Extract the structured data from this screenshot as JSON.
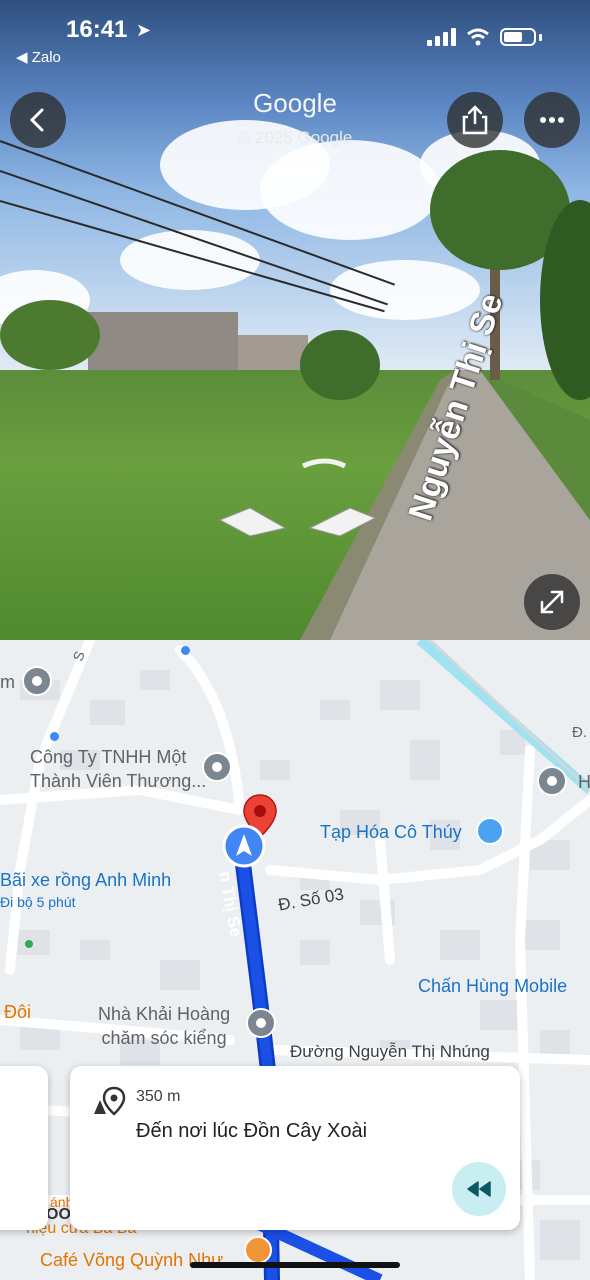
{
  "status_bar": {
    "time": "16:41",
    "back_app": "◀ Zalo"
  },
  "street_view": {
    "title": "Google",
    "copyright": "© 2025 Google",
    "street_name": "Nguyễn Thị Se",
    "icons": {
      "back": "chevron-left-icon",
      "share": "share-icon",
      "more": "more-icon",
      "expand": "expand-icon"
    }
  },
  "map": {
    "labels": {
      "company": [
        "Công Ty TNHH Một",
        "Thành Viên Thương..."
      ],
      "grocery": "Tạp Hóa Cô Thúy",
      "parking": "Bãi xe rồng Anh Minh",
      "parking_sub": "Đi bộ 5 phút",
      "street_03": "Đ. Số 03",
      "route_street": "n Thị Se",
      "mobile": "Chấn Hùng Mobile",
      "doi": "Đôi",
      "garden": [
        "Nhà Khải Hoàng",
        "chăm sóc kiểng"
      ],
      "nhung": "Đường Nguyễn Thị Nhúng",
      "cafe": "Café Võng Quỳnh Như",
      "partial_top": "S",
      "partial_m": "m",
      "partial_h": "H",
      "partial_d": "Đ.",
      "partial_hieu": "hiệu cửa Ba Ba",
      "partial_oo": "OO",
      "partial_anh": "ánh"
    },
    "colors": {
      "route": "#1a50e6",
      "marker": "#ea4335",
      "nav_dot": "#4285f4"
    }
  },
  "navigation_card": {
    "distance": "350 m",
    "instruction": "Đến nơi lúc Đồn Cây Xoài",
    "icons": {
      "destination": "destination-icon",
      "rewind": "rewind-icon"
    }
  }
}
